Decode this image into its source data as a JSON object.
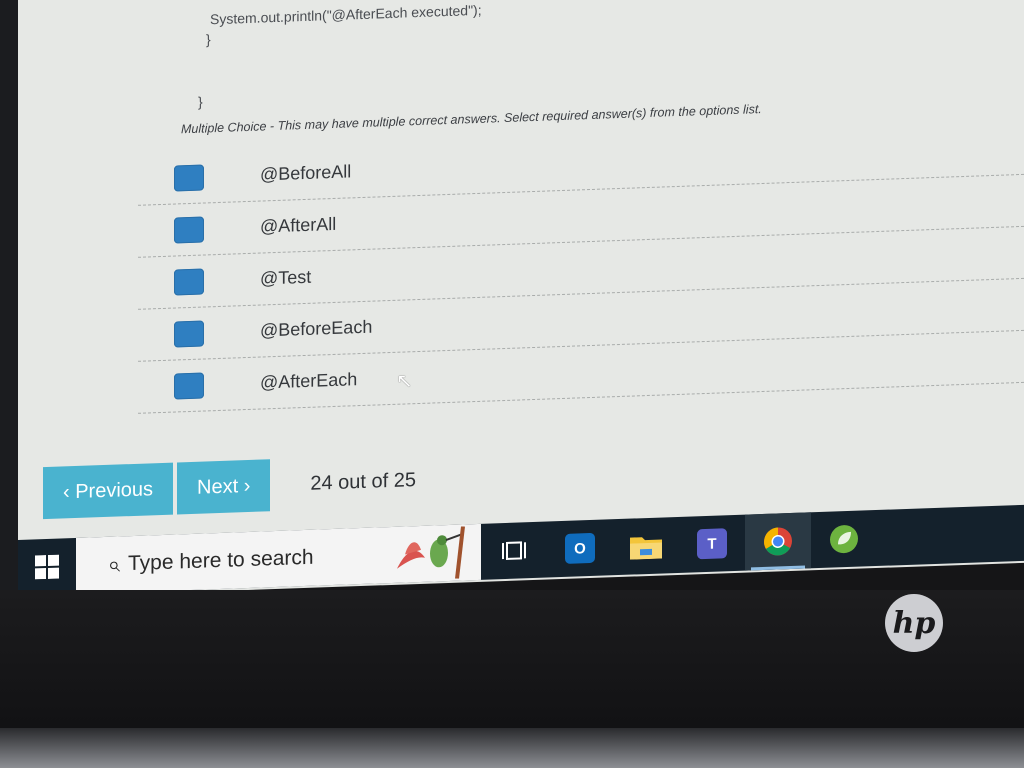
{
  "code": {
    "line1": "System.out.println(\"@AfterEach executed\");",
    "line2": "}",
    "line3": "}"
  },
  "question": {
    "instruction": "Multiple Choice - This may have multiple correct answers. Select required answer(s) from the options list.",
    "options": [
      {
        "label": "@BeforeAll"
      },
      {
        "label": "@AfterAll"
      },
      {
        "label": "@Test"
      },
      {
        "label": "@BeforeEach"
      },
      {
        "label": "@AfterEach"
      }
    ]
  },
  "nav": {
    "previous_label": "‹ Previous",
    "next_label": "Next ›",
    "page_count": "24 out of 25"
  },
  "taskbar": {
    "search_placeholder": "Type here to search",
    "apps": [
      "task-view-icon",
      "outlook-icon",
      "file-explorer-icon",
      "teams-icon",
      "chrome-icon",
      "spring-tools-icon"
    ]
  },
  "brand": {
    "logo": "hp"
  },
  "colors": {
    "checkbox": "#2f7fc1",
    "nav_button": "#4ab3cf",
    "taskbar": "#14212c"
  }
}
